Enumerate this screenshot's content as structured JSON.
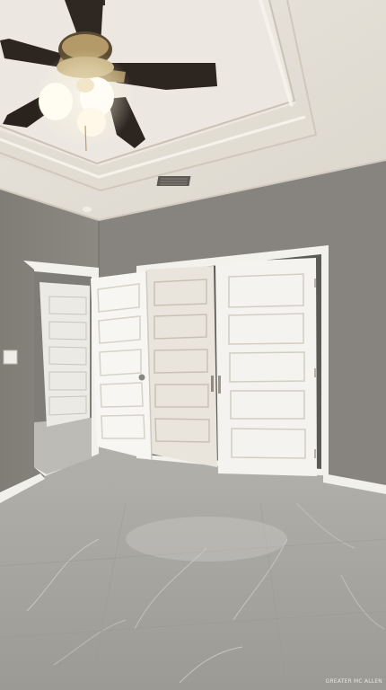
{
  "photo": {
    "subject": "empty bedroom with ceiling fan and closet doors",
    "palette": {
      "wall": "#86837c",
      "wall_light": "#8e8b84",
      "ceiling": "#e6e2da",
      "trim": "#f4f3ef",
      "door": "#f1efea",
      "floor": "#a9a7a3",
      "fan_blade": "#2c2520",
      "light_glow": "#fff8e6"
    }
  },
  "watermark": {
    "text": "GREATER MC ALLEN"
  }
}
